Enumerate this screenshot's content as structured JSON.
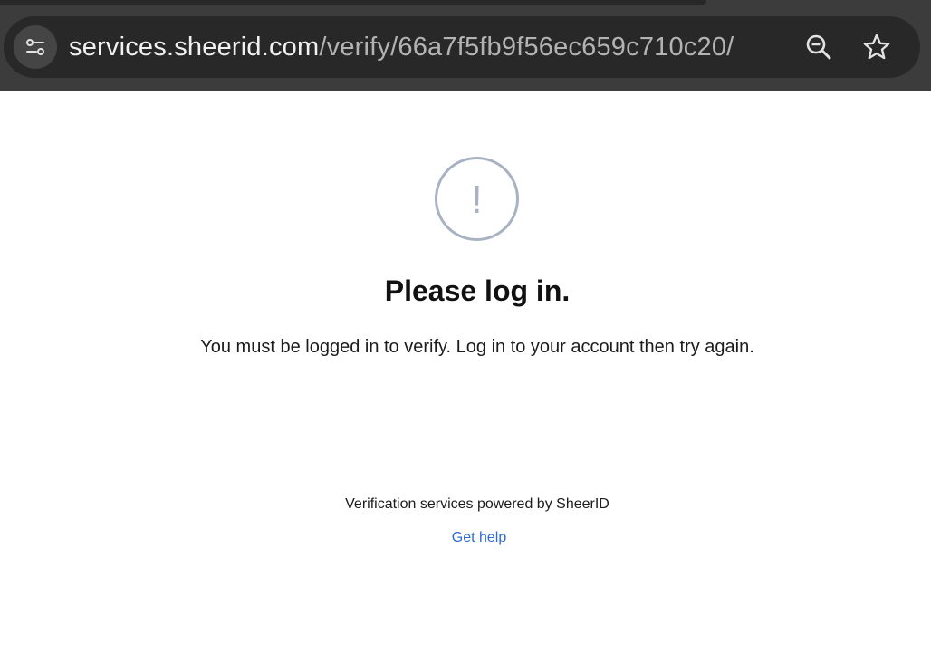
{
  "browser": {
    "url_host": "services.sheerid.com",
    "url_path": "/verify/66a7f5fb9f56ec659c710c20/",
    "icons": {
      "site_info": "tune-icon",
      "zoom": "zoom-out-icon",
      "bookmark": "star-outline-icon"
    }
  },
  "page": {
    "alert_symbol": "!",
    "title": "Please log in.",
    "message": "You must be logged in to verify. Log in to your account then try again.",
    "footer_text": "Verification services powered by SheerID",
    "help_link_label": "Get help"
  },
  "colors": {
    "alert_icon": "#a9b2c3",
    "link": "#2e6bd4",
    "toolbar": "#3c3c3c",
    "omnibox": "#282828"
  }
}
